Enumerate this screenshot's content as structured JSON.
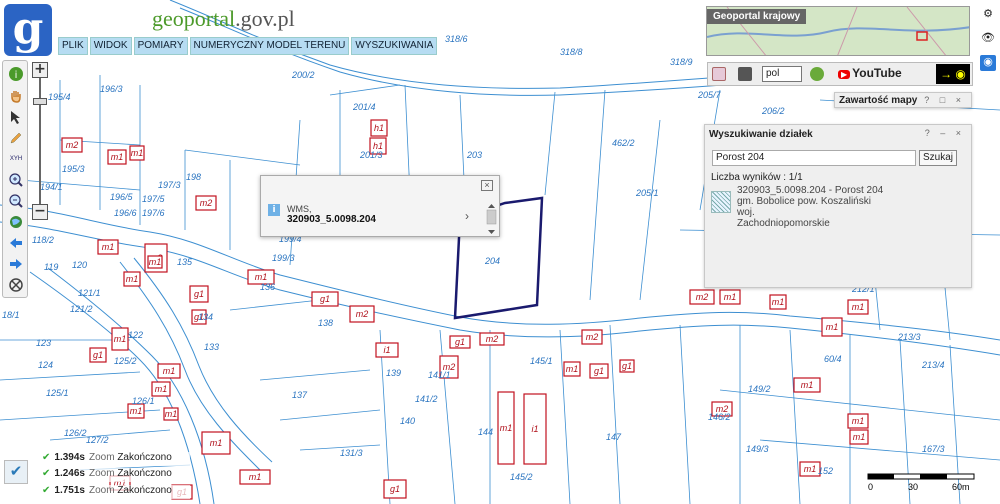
{
  "app": {
    "brand_prefix": "geoportal",
    "brand_suffix": ".gov.pl",
    "logo_letter": "g"
  },
  "menu": [
    "PLIK",
    "WIDOK",
    "POMIARY",
    "NUMERYCZNY MODEL TERENU",
    "WYSZUKIWANIA"
  ],
  "toolbar": {
    "icons": [
      "info-icon",
      "pan-hand-icon",
      "select-arrow-icon",
      "draw-pencil-icon",
      "xyh-coordinates-icon",
      "zoom-in-icon",
      "zoom-out-icon",
      "globe-extent-icon",
      "back-arrow-icon",
      "forward-arrow-icon",
      "clear-icon"
    ],
    "xyh_label": "XYH",
    "zoom_plus": "+",
    "zoom_minus": "−"
  },
  "popup": {
    "line1": "WMS,",
    "line2": "320903_5.0098.204",
    "close": "×",
    "info": "i",
    "chevron": "›"
  },
  "minimap": {
    "title": "Geoportal krajowy"
  },
  "right_toolbar": {
    "lang": "pol",
    "youtube": "YouTube",
    "eye_arrow": "→",
    "eye": "◉"
  },
  "layers_panel": {
    "title": "Zawartość mapy",
    "buttons": "? □ ×"
  },
  "search_panel": {
    "title": "Wyszukiwanie działek",
    "buttons": "? – ×",
    "input_value": "Porost 204",
    "search_button": "Szukaj",
    "results_label": "Liczba wyników : 1/1",
    "result_lines": [
      "320903_5.0098.204 - Porost 204",
      "gm. Bobolice pow. Koszaliński woj.",
      "Zachodniopomorskie"
    ]
  },
  "status": [
    {
      "time": "1.394s",
      "action": "Zoom",
      "state": "Zakończono"
    },
    {
      "time": "1.246s",
      "action": "Zoom",
      "state": "Zakończono"
    },
    {
      "time": "1.751s",
      "action": "Zoom",
      "state": "Zakończono"
    }
  ],
  "scale": {
    "labels": [
      "0",
      "30",
      "60m"
    ]
  },
  "map_labels": [
    {
      "t": "318/6",
      "k": "parcel"
    },
    {
      "t": "318/8",
      "k": "parcel"
    },
    {
      "t": "318/9",
      "k": "parcel"
    },
    {
      "t": "200/2",
      "k": "parcel"
    },
    {
      "t": "196/3",
      "k": "parcel"
    },
    {
      "t": "195/4",
      "k": "parcel"
    },
    {
      "t": "201/4",
      "k": "parcel"
    },
    {
      "t": "201/3",
      "k": "parcel"
    },
    {
      "t": "203",
      "k": "parcel"
    },
    {
      "t": "462/2",
      "k": "parcel"
    },
    {
      "t": "205/7",
      "k": "parcel"
    },
    {
      "t": "206/2",
      "k": "parcel"
    },
    {
      "t": "205/1",
      "k": "parcel"
    },
    {
      "t": "195/3",
      "k": "parcel"
    },
    {
      "t": "194/1",
      "k": "parcel"
    },
    {
      "t": "196/5",
      "k": "parcel"
    },
    {
      "t": "196/6",
      "k": "parcel"
    },
    {
      "t": "197/3",
      "k": "parcel"
    },
    {
      "t": "197/5",
      "k": "parcel"
    },
    {
      "t": "197/6",
      "k": "parcel"
    },
    {
      "t": "198",
      "k": "parcel"
    },
    {
      "t": "199/4",
      "k": "parcel"
    },
    {
      "t": "199/3",
      "k": "parcel"
    },
    {
      "t": "204",
      "k": "parcel"
    },
    {
      "t": "118/2",
      "k": "parcel"
    },
    {
      "t": "119",
      "k": "parcel"
    },
    {
      "t": "120",
      "k": "parcel"
    },
    {
      "t": "135",
      "k": "parcel"
    },
    {
      "t": "136",
      "k": "parcel"
    },
    {
      "t": "213/1",
      "k": "parcel"
    },
    {
      "t": "18/1",
      "k": "parcel"
    },
    {
      "t": "121/2",
      "k": "parcel"
    },
    {
      "t": "121/1",
      "k": "parcel"
    },
    {
      "t": "134",
      "k": "parcel"
    },
    {
      "t": "138",
      "k": "parcel"
    },
    {
      "t": "123",
      "k": "parcel"
    },
    {
      "t": "122",
      "k": "parcel"
    },
    {
      "t": "133",
      "k": "parcel"
    },
    {
      "t": "124",
      "k": "parcel"
    },
    {
      "t": "125/2",
      "k": "parcel"
    },
    {
      "t": "139",
      "k": "parcel"
    },
    {
      "t": "145/1",
      "k": "parcel"
    },
    {
      "t": "60/4",
      "k": "parcel"
    },
    {
      "t": "213/4",
      "k": "parcel"
    },
    {
      "t": "213/3",
      "k": "parcel"
    },
    {
      "t": "125/1",
      "k": "parcel"
    },
    {
      "t": "126/1",
      "k": "parcel"
    },
    {
      "t": "137",
      "k": "parcel"
    },
    {
      "t": "141/1",
      "k": "parcel"
    },
    {
      "t": "141/2",
      "k": "parcel"
    },
    {
      "t": "140",
      "k": "parcel"
    },
    {
      "t": "149/2",
      "k": "parcel"
    },
    {
      "t": "126/2",
      "k": "parcel"
    },
    {
      "t": "127/2",
      "k": "parcel"
    },
    {
      "t": "131/3",
      "k": "parcel"
    },
    {
      "t": "144",
      "k": "parcel"
    },
    {
      "t": "147",
      "k": "parcel"
    },
    {
      "t": "149/3",
      "k": "parcel"
    },
    {
      "t": "146/2",
      "k": "parcel"
    },
    {
      "t": "167/3",
      "k": "parcel"
    },
    {
      "t": "145/2",
      "k": "parcel"
    },
    {
      "t": "152",
      "k": "parcel"
    },
    {
      "t": "212/1",
      "k": "parcel"
    }
  ],
  "buildings": [
    {
      "t": "m2"
    },
    {
      "t": "m1"
    },
    {
      "t": "m1"
    },
    {
      "t": "h1"
    },
    {
      "t": "h1"
    },
    {
      "t": "m2"
    },
    {
      "t": "m1"
    },
    {
      "t": "m1"
    },
    {
      "t": "m3"
    },
    {
      "t": "m1"
    },
    {
      "t": "m1"
    },
    {
      "t": "g1"
    },
    {
      "t": "m1"
    },
    {
      "t": "m1"
    },
    {
      "t": "g1"
    },
    {
      "t": "m2"
    },
    {
      "t": "i1"
    },
    {
      "t": "g1"
    },
    {
      "t": "m2"
    },
    {
      "t": "m2"
    },
    {
      "t": "m1"
    },
    {
      "t": "m1"
    },
    {
      "t": "m1"
    },
    {
      "t": "m1"
    },
    {
      "t": "g1"
    },
    {
      "t": "g1"
    },
    {
      "t": "g1"
    },
    {
      "t": "m2"
    },
    {
      "t": "m1"
    },
    {
      "t": "g1"
    },
    {
      "t": "m1"
    },
    {
      "t": "m2"
    },
    {
      "t": "m1"
    },
    {
      "t": "m1"
    },
    {
      "t": "m1"
    },
    {
      "t": "m1"
    },
    {
      "t": "m1"
    },
    {
      "t": "g1"
    },
    {
      "t": "g1"
    },
    {
      "t": "m1"
    },
    {
      "t": "i1"
    },
    {
      "t": "m1"
    },
    {
      "t": "m1"
    },
    {
      "t": "m2"
    },
    {
      "t": "m1"
    },
    {
      "t": "m1"
    }
  ]
}
